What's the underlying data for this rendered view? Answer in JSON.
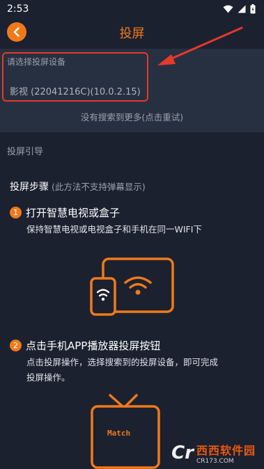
{
  "status_bar": {
    "time": "2:53"
  },
  "header": {
    "title": "投屏"
  },
  "device_section": {
    "header": "请选择投屏设备",
    "device": "影视 (22041216C)(10.0.2.15)",
    "more": "没有搜索到更多(点击重试)"
  },
  "guide": {
    "label": "投屏引导"
  },
  "steps": {
    "title": "投屏步骤",
    "note": "(此方法不支持弹幕显示)",
    "step1": {
      "num": "1",
      "title": "打开智慧电视或盒子",
      "desc": "保持智慧电视或电视盒子和手机在同一WIFI下"
    },
    "step2": {
      "num": "2",
      "title": "点击手机APP播放器投屏按钮",
      "desc_line1": "点击投屏操作，选择搜索到的投屏设备，即可完成",
      "desc_line2": "投屏操作。"
    }
  },
  "illustration2": {
    "screen_text": "Match"
  },
  "watermark": {
    "brand": "西西软件园",
    "site": "CR173.COM",
    "logo": "Cr"
  },
  "colors": {
    "accent": "#f07a1a",
    "background": "#1c2130",
    "panel": "#273040",
    "highlight": "#e5392b"
  }
}
